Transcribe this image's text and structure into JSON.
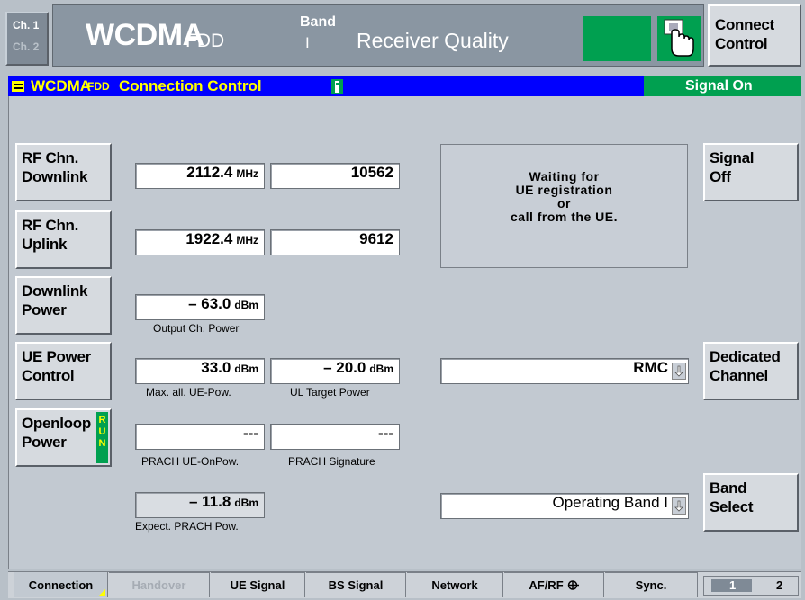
{
  "header": {
    "ch1": "Ch. 1",
    "ch2": "Ch. 2",
    "standard": "WCDMA",
    "standard_sub": "FDD",
    "band_label": "Band",
    "band_value": "I",
    "measurement": "Receiver Quality",
    "connect_control": "Connect\nControl"
  },
  "title_bar": {
    "standard": "WCDMA",
    "standard_sub": "FDD",
    "title": "Connection Control",
    "status": "Signal On",
    "colors": {
      "bar": "#0000ff",
      "status": "#00a050"
    }
  },
  "left_buttons": {
    "rf_downlink": "RF Chn.\nDownlink",
    "rf_uplink": "RF Chn.\nUplink",
    "downlink_power": "Downlink\nPower",
    "ue_power_control": "UE Power\nControl",
    "openloop_power": "Openloop\nPower",
    "openloop_badge": "R\nU\nN"
  },
  "fields": {
    "dl_freq": {
      "value": "2112.4",
      "unit": "MHz"
    },
    "dl_channel": {
      "value": "10562"
    },
    "ul_freq": {
      "value": "1922.4",
      "unit": "MHz"
    },
    "ul_channel": {
      "value": "9612"
    },
    "output_power": {
      "value": "– 63.0",
      "unit": "dBm",
      "caption": "Output Ch. Power"
    },
    "max_ue_power": {
      "value": "33.0",
      "unit": "dBm",
      "caption": "Max. all. UE-Pow."
    },
    "ul_target_power": {
      "value": "– 20.0",
      "unit": "dBm",
      "caption": "UL Target Power"
    },
    "prach_ue_on_pow": {
      "value": "---",
      "caption": "PRACH UE-OnPow."
    },
    "prach_signature": {
      "value": "---",
      "caption": "PRACH Signature"
    },
    "expect_prach_pow": {
      "value": "– 11.8",
      "unit": "dBm",
      "caption": "Expect. PRACH Pow."
    }
  },
  "message": "Waiting for\nUE registration\nor\ncall from the UE.",
  "dedicated_channel": {
    "selected": "RMC"
  },
  "band_select": {
    "selected": "Operating Band I"
  },
  "right_buttons": {
    "signal_off": "Signal\nOff",
    "dedicated_channel": "Dedicated\nChannel",
    "band_select": "Band\nSelect"
  },
  "tabs": [
    {
      "label": "Connection",
      "active": true
    },
    {
      "label": "Handover",
      "disabled": true
    },
    {
      "label": "UE Signal"
    },
    {
      "label": "BS Signal"
    },
    {
      "label": "Network"
    },
    {
      "label": "AF/RF"
    },
    {
      "label": "Sync."
    }
  ],
  "pager": {
    "page1": "1",
    "page2": "2"
  }
}
